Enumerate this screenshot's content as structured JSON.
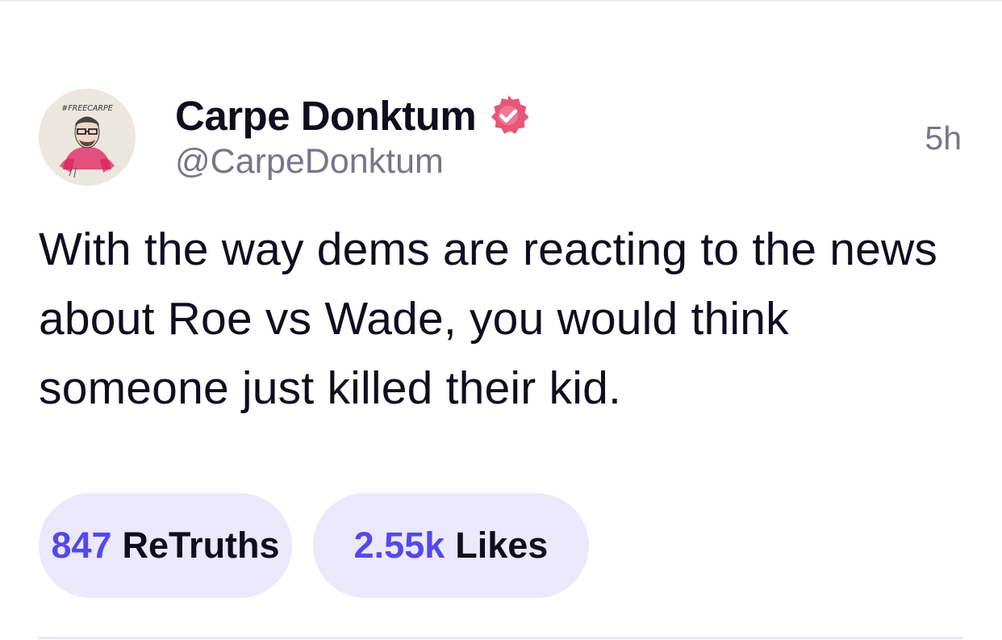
{
  "post": {
    "author": {
      "display_name": "Carpe Donktum",
      "handle": "@CarpeDonktum",
      "verified": true,
      "avatar_caption": "#FREECARPE",
      "avatar_icon": "caricature-portrait-avatar"
    },
    "timestamp": "5h",
    "text": "With the way dems are reacting to the news about Roe vs Wade, you would think someone just killed their kid.",
    "stats": {
      "retruths_count": "847",
      "retruths_label": "ReTruths",
      "likes_count": "2.55k",
      "likes_label": "Likes"
    }
  },
  "colors": {
    "accent": "#5448ee",
    "pill_background": "#ebe9fb",
    "verified_badge": "#e8567a",
    "muted_text": "#77768a",
    "primary_text": "#0f0e1f"
  },
  "icons": {
    "verified": "verified-badge-icon"
  }
}
